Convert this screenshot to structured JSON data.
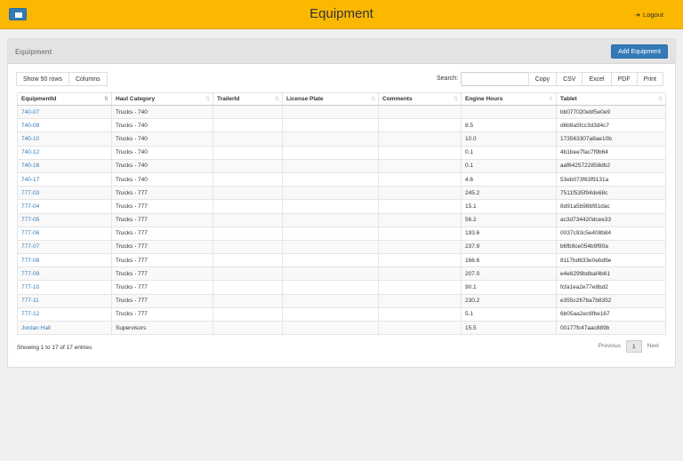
{
  "header": {
    "title": "Equipment",
    "logout_label": "Logout"
  },
  "panel": {
    "title": "Equipment",
    "add_button": "Add Equipment"
  },
  "toolbar": {
    "show_rows": "Show 50 rows",
    "columns": "Columns",
    "search_label": "Search:",
    "search_value": "",
    "export_buttons": [
      "Copy",
      "CSV",
      "Excel",
      "PDF",
      "Print"
    ]
  },
  "table": {
    "headers": [
      "EquipmentId",
      "Haul Category",
      "TrailerId",
      "License Plate",
      "Comments",
      "Engine Hours",
      "Tablet"
    ],
    "rows": [
      [
        "740-07",
        "Trucks - 740",
        "",
        "",
        "",
        "",
        "bb077020ebf5e0e9"
      ],
      [
        "740-09",
        "Trucks - 740",
        "",
        "",
        "",
        "8.5",
        "d6b8a5fcc3d3d4c7"
      ],
      [
        "740-10",
        "Trucks - 740",
        "",
        "",
        "",
        "10.0",
        "173563307a8ae10b"
      ],
      [
        "740-12",
        "Trucks - 740",
        "",
        "",
        "",
        "0.1",
        "4b1bee7fac7f9b64"
      ],
      [
        "740-16",
        "Trucks - 740",
        "",
        "",
        "",
        "0.1",
        "aaf6425722858db2"
      ],
      [
        "740-17",
        "Trucks - 740",
        "",
        "",
        "",
        "4.6",
        "53eb073f63f9131a"
      ],
      [
        "777-03",
        "Trucks - 777",
        "",
        "",
        "",
        "245.2",
        "7511f535f94de68c"
      ],
      [
        "777-04",
        "Trucks - 777",
        "",
        "",
        "",
        "15.1",
        "8d91a5b98bf81dac"
      ],
      [
        "777-05",
        "Trucks - 777",
        "",
        "",
        "",
        "56.2",
        "ac3d734420dcee33"
      ],
      [
        "777-06",
        "Trucks - 777",
        "",
        "",
        "",
        "193.6",
        "0037c93c5e408b84"
      ],
      [
        "777-07",
        "Trucks - 777",
        "",
        "",
        "",
        "237.9",
        "b6fb9ce054b9f90a"
      ],
      [
        "777-08",
        "Trucks - 777",
        "",
        "",
        "",
        "166.6",
        "8117bd633e0ebd9e"
      ],
      [
        "777-09",
        "Trucks - 777",
        "",
        "",
        "",
        "207.0",
        "e4e6299bdbaf4b61"
      ],
      [
        "777-10",
        "Trucks - 777",
        "",
        "",
        "",
        "90.1",
        "fcfa1ea2e77e8bd2"
      ],
      [
        "777-11",
        "Trucks - 777",
        "",
        "",
        "",
        "230.2",
        "e355c267ba7b8352"
      ],
      [
        "777-12",
        "Trucks - 777",
        "",
        "",
        "",
        "5.1",
        "6b05aa2ec6fbe167"
      ],
      [
        "Jordan Hall",
        "Supervisors",
        "",
        "",
        "",
        "15.5",
        "00177fc47aac889b"
      ]
    ]
  },
  "footer": {
    "info": "Showing 1 to 17 of 17 entries",
    "previous": "Previous",
    "current_page": "1",
    "next": "Next"
  }
}
